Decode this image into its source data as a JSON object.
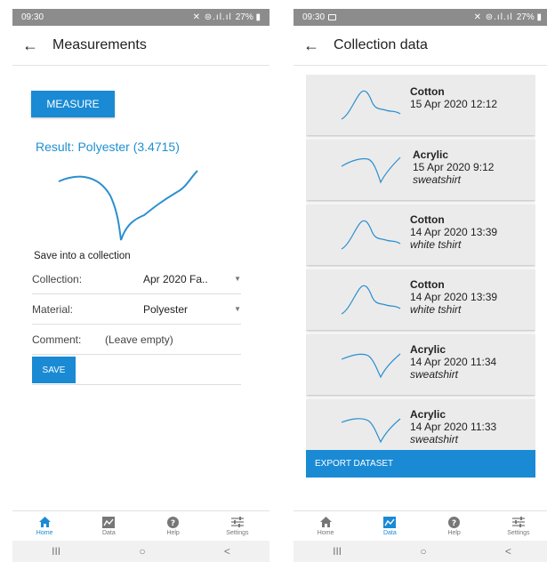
{
  "colors": {
    "accent": "#1a8ad4",
    "result_text": "#1e90d0",
    "card_bg": "#ebebeb",
    "status_bar": "#8c8c8c"
  },
  "left_screen": {
    "status": {
      "time": "09:30",
      "icons": "✕ ⊜.ıl.ıl",
      "battery": "27% ▮"
    },
    "title": "Measurements",
    "measure_label": "MEASURE",
    "result_text": "Result: Polyester (3.4715)",
    "section_label": "Save into a collection",
    "collection": {
      "label": "Collection:",
      "value": "Apr 2020 Fa.."
    },
    "material": {
      "label": "Material:",
      "value": "Polyester"
    },
    "comment": {
      "label": "Comment:",
      "placeholder": "(Leave empty)"
    },
    "save_label": "SAVE",
    "nav": [
      {
        "label": "Home",
        "icon": "home-icon",
        "active": true
      },
      {
        "label": "Data",
        "icon": "chart-icon",
        "active": false
      },
      {
        "label": "Help",
        "icon": "help-icon",
        "active": false
      },
      {
        "label": "Settings",
        "icon": "sliders-icon",
        "active": false
      }
    ],
    "system_nav": {
      "recent": "III",
      "home": "○",
      "back": "<"
    }
  },
  "right_screen": {
    "status": {
      "time": "09:30",
      "icons": "✕ ⊜.ıl.ıl",
      "battery": "27% ▮"
    },
    "title": "Collection data",
    "cards": [
      {
        "material": "Cotton",
        "datetime": "15 Apr 2020 12:12",
        "comment": ""
      },
      {
        "material": "Acrylic",
        "datetime": "15 Apr 2020 9:12",
        "comment": "sweatshirt"
      },
      {
        "material": "Cotton",
        "datetime": "14 Apr 2020 13:39",
        "comment": "white tshirt"
      },
      {
        "material": "Cotton",
        "datetime": "14 Apr 2020 13:39",
        "comment": "white tshirt"
      },
      {
        "material": "Acrylic",
        "datetime": "14 Apr 2020 11:34",
        "comment": "sweatshirt"
      },
      {
        "material": "Acrylic",
        "datetime": "14 Apr 2020 11:33",
        "comment": "sweatshirt"
      }
    ],
    "export_label": "EXPORT DATASET",
    "nav": [
      {
        "label": "Home",
        "icon": "home-icon",
        "active": false
      },
      {
        "label": "Data",
        "icon": "chart-icon",
        "active": true
      },
      {
        "label": "Help",
        "icon": "help-icon",
        "active": false
      },
      {
        "label": "Settings",
        "icon": "sliders-icon",
        "active": false
      }
    ],
    "system_nav": {
      "recent": "III",
      "home": "○",
      "back": "<"
    }
  }
}
